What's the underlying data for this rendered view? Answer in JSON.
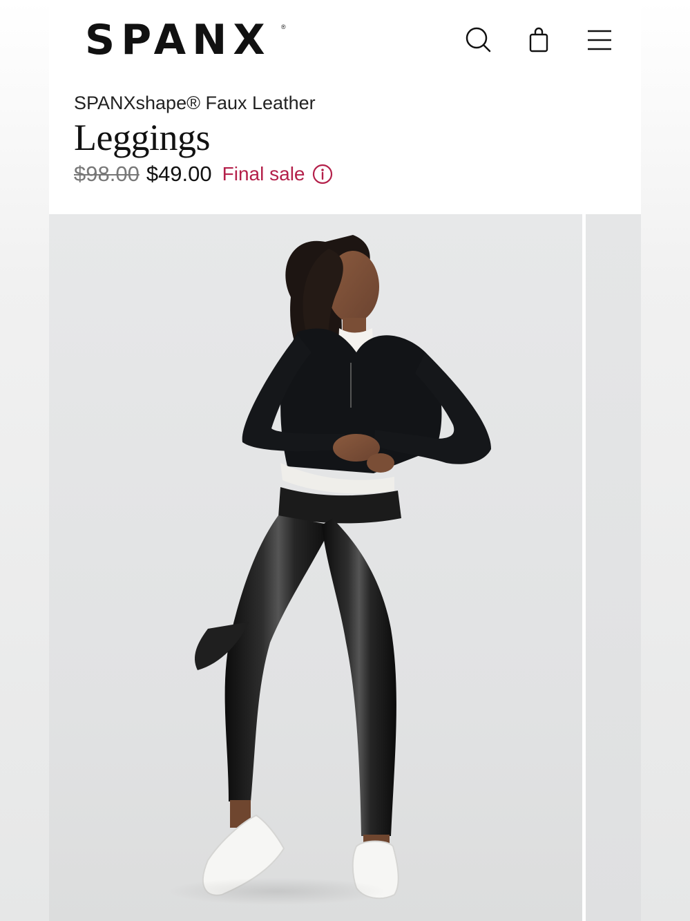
{
  "header": {
    "logo_text": "SPANX",
    "logo_reg": "®",
    "icons": [
      "search-icon",
      "shopping-bag-icon",
      "menu-icon"
    ]
  },
  "product": {
    "subtitle": "SPANXshape® Faux Leather",
    "title": "Leggings",
    "original_price": "$98.00",
    "sale_price": "$49.00",
    "sale_label": "Final sale",
    "info_icon": "info-icon"
  },
  "gallery": {
    "images": [
      "product-photo-model-leggings",
      "product-photo-next"
    ]
  },
  "colors": {
    "sale_accent": "#b4204a",
    "text_primary": "#111111",
    "text_strike": "#777777"
  }
}
